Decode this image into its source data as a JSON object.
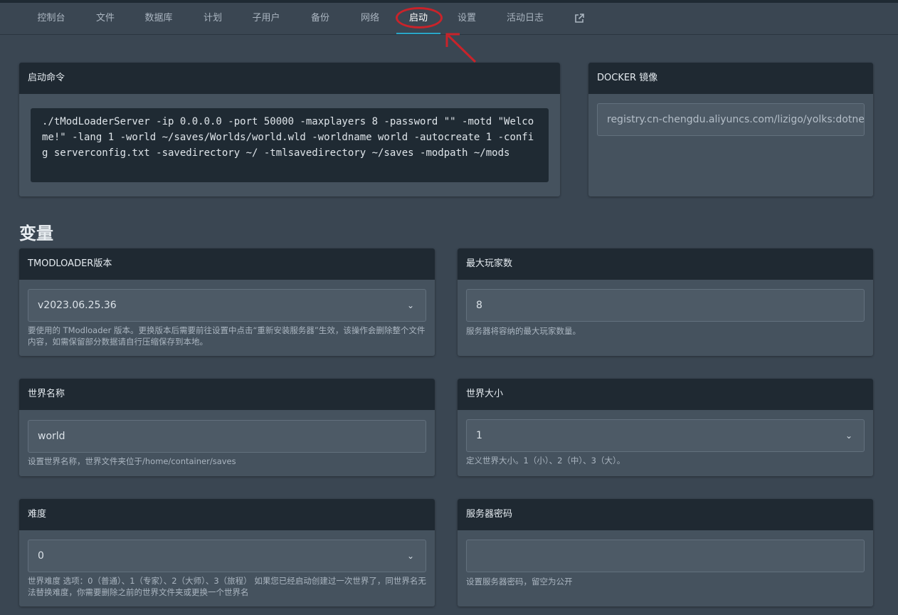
{
  "nav": {
    "items": [
      "控制台",
      "文件",
      "数据库",
      "计划",
      "子用户",
      "备份",
      "网络",
      "启动",
      "设置",
      "活动日志"
    ],
    "active": "启动",
    "external_icon": "external-link-icon"
  },
  "startup": {
    "title": "启动命令",
    "command": "./tModLoaderServer -ip 0.0.0.0 -port 50000 -maxplayers 8 -password \"\" -motd \"Welcome!\" -lang 1 -world ~/saves/Worlds/world.wld -worldname world -autocreate 1 -config serverconfig.txt -savedirectory ~/ -tmlsavedirectory ~/saves -modpath ~/mods"
  },
  "docker": {
    "title": "DOCKER 镜像",
    "value": "registry.cn-chengdu.aliyuncs.com/lizigo/yolks:dotne"
  },
  "variables_title": "变量",
  "variables": {
    "version": {
      "title": "TMODLOADER版本",
      "value": "v2023.06.25.36",
      "hint": "要使用的 TModloader 版本。更换版本后需要前往设置中点击“重新安装服务器”生效，该操作会删除整个文件内容，如需保留部分数据请自行压缩保存到本地。"
    },
    "max_players": {
      "title": "最大玩家数",
      "value": "8",
      "hint": "服务器将容纳的最大玩家数量。"
    },
    "world_name": {
      "title": "世界名称",
      "value": "world",
      "hint": "设置世界名称，世界文件夹位于/home/container/saves"
    },
    "world_size": {
      "title": "世界大小",
      "value": "1",
      "hint": "定义世界大小。1（小）、2（中）、3（大）。"
    },
    "difficulty": {
      "title": "难度",
      "value": "0",
      "hint": "世界难度 选项：0（普通）、1（专家）、2（大师）、3（旅程） 如果您已经启动创建过一次世界了，同世界名无法替换难度，你需要删除之前的世界文件夹或更换一个世界名"
    },
    "password": {
      "title": "服务器密码",
      "value": "",
      "hint": "设置服务器密码，留空为公开"
    }
  },
  "colors": {
    "background": "#3a4652",
    "panel": "#45525e",
    "panel_header": "#1f2932",
    "accent": "#2aa6c8",
    "annotation": "#c9232a"
  }
}
